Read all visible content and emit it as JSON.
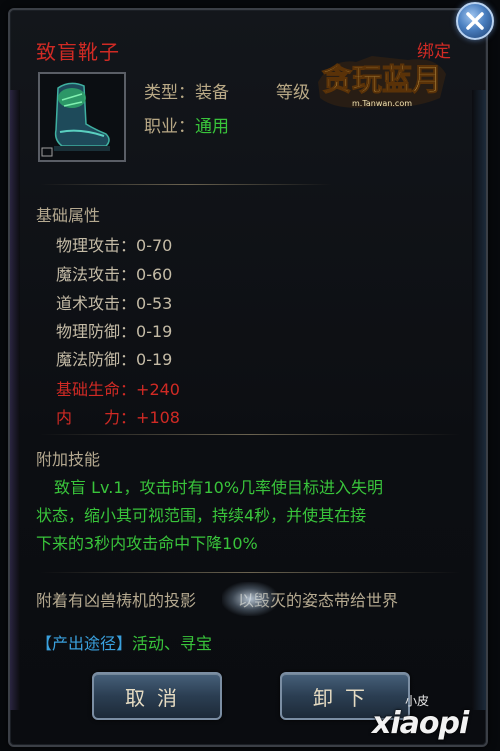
{
  "item": {
    "name": "致盲靴子",
    "bind_status": "绑定",
    "type_label": "类型：",
    "type_value": "装备",
    "level_label": "等级",
    "job_label": "职业：",
    "job_value": "通用"
  },
  "logo": {
    "title": "贪玩蓝月",
    "subtitle": "m.Tanwan.com"
  },
  "base_attrs": {
    "title": "基础属性",
    "rows": [
      {
        "label": "物理攻击",
        "value": "0-70"
      },
      {
        "label": "魔法攻击",
        "value": "0-60"
      },
      {
        "label": "道术攻击",
        "value": "0-53"
      },
      {
        "label": "物理防御",
        "value": "0-19"
      },
      {
        "label": "魔法防御",
        "value": "0-19"
      }
    ],
    "bonus_rows": [
      {
        "label": "基础生命",
        "value": "+240"
      },
      {
        "label": "内　　力",
        "value": "+108"
      }
    ]
  },
  "skill": {
    "title": "附加技能",
    "lines": [
      "致盲 Lv.1，攻击时有10%几率使目标进入失明",
      "状态，缩小其可视范围，持续4秒，并使其在接",
      "下来的3秒内攻击命中下降10%"
    ]
  },
  "flavor": {
    "left": "附着有凶兽梼机的投影",
    "right": "以毁灭的姿态带给世界"
  },
  "source": {
    "label": "【产出途径】",
    "value": "活动、寻宝"
  },
  "buttons": {
    "cancel": "取消",
    "unequip": "卸下"
  },
  "watermark": {
    "small": "小皮",
    "big": "xiaopi"
  },
  "colors": {
    "name_red": "#d02a24",
    "green": "#39c43b",
    "label_tan": "#b9a986",
    "source_blue": "#3aa0dd"
  }
}
